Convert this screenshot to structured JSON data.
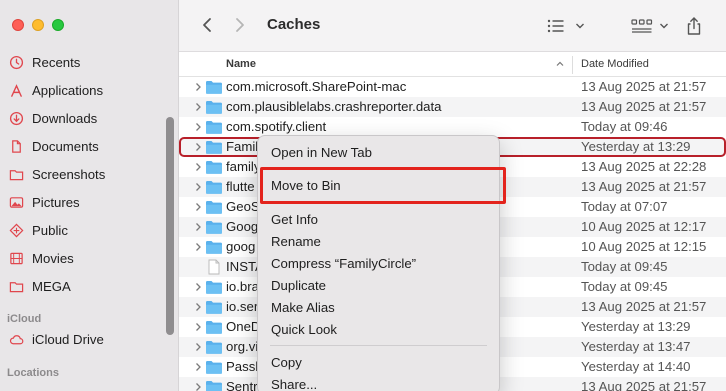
{
  "window": {
    "title": "Caches"
  },
  "sidebar": {
    "items": [
      {
        "label": "Recents",
        "icon": "clock-icon"
      },
      {
        "label": "Applications",
        "icon": "applications-icon"
      },
      {
        "label": "Downloads",
        "icon": "download-icon"
      },
      {
        "label": "Documents",
        "icon": "document-icon"
      },
      {
        "label": "Screenshots",
        "icon": "folder-icon"
      },
      {
        "label": "Pictures",
        "icon": "photo-icon"
      },
      {
        "label": "Public",
        "icon": "public-icon"
      },
      {
        "label": "Movies",
        "icon": "film-icon"
      },
      {
        "label": "MEGA",
        "icon": "folder-icon"
      }
    ],
    "icloud_section": "iCloud",
    "icloud_items": [
      {
        "label": "iCloud Drive",
        "icon": "cloud-icon"
      }
    ],
    "locations_section": "Locations"
  },
  "list": {
    "col_name": "Name",
    "col_date": "Date Modified",
    "rows": [
      {
        "name": "com.microsoft.SharePoint-mac",
        "date": "13 Aug 2025 at 21:57",
        "kind": "folder"
      },
      {
        "name": "com.plausiblelabs.crashreporter.data",
        "date": "13 Aug 2025 at 21:57",
        "kind": "folder"
      },
      {
        "name": "com.spotify.client",
        "date": "Today at 09:46",
        "kind": "folder"
      },
      {
        "name": "Famil",
        "date": "Yesterday at 13:29",
        "kind": "folder"
      },
      {
        "name": "family",
        "date": "13 Aug 2025 at 22:28",
        "kind": "folder"
      },
      {
        "name": "flutte",
        "date": "13 Aug 2025 at 21:57",
        "kind": "folder"
      },
      {
        "name": "GeoS",
        "date": "Today at 07:07",
        "kind": "folder"
      },
      {
        "name": "Goog",
        "date": "10 Aug 2025 at 12:17",
        "kind": "folder"
      },
      {
        "name": "goog",
        "date": "10 Aug 2025 at 12:15",
        "kind": "folder"
      },
      {
        "name": "INSTA",
        "date": "Today at 09:45",
        "kind": "file"
      },
      {
        "name": "io.bra",
        "date": "Today at 09:45",
        "kind": "folder"
      },
      {
        "name": "io.ser",
        "date": "13 Aug 2025 at 21:57",
        "kind": "folder"
      },
      {
        "name": "OneD",
        "date": "Yesterday at 13:29",
        "kind": "folder"
      },
      {
        "name": "org.vi",
        "date": "Yesterday at 13:47",
        "kind": "folder"
      },
      {
        "name": "Passk",
        "date": "Yesterday at 14:40",
        "kind": "folder"
      },
      {
        "name": "Sentr",
        "date": "13 Aug 2025 at 21:57",
        "kind": "folder"
      }
    ]
  },
  "context_menu": {
    "open_new_tab": "Open in New Tab",
    "move_to_bin": "Move to Bin",
    "get_info": "Get Info",
    "rename": "Rename",
    "compress": "Compress “FamilyCircle”",
    "duplicate": "Duplicate",
    "make_alias": "Make Alias",
    "quick_look": "Quick Look",
    "copy": "Copy",
    "share": "Share..."
  },
  "colors": {
    "folder_blue": "#5ab1ec",
    "highlight_red": "#e3231c",
    "selection_outline": "#b8202a"
  }
}
